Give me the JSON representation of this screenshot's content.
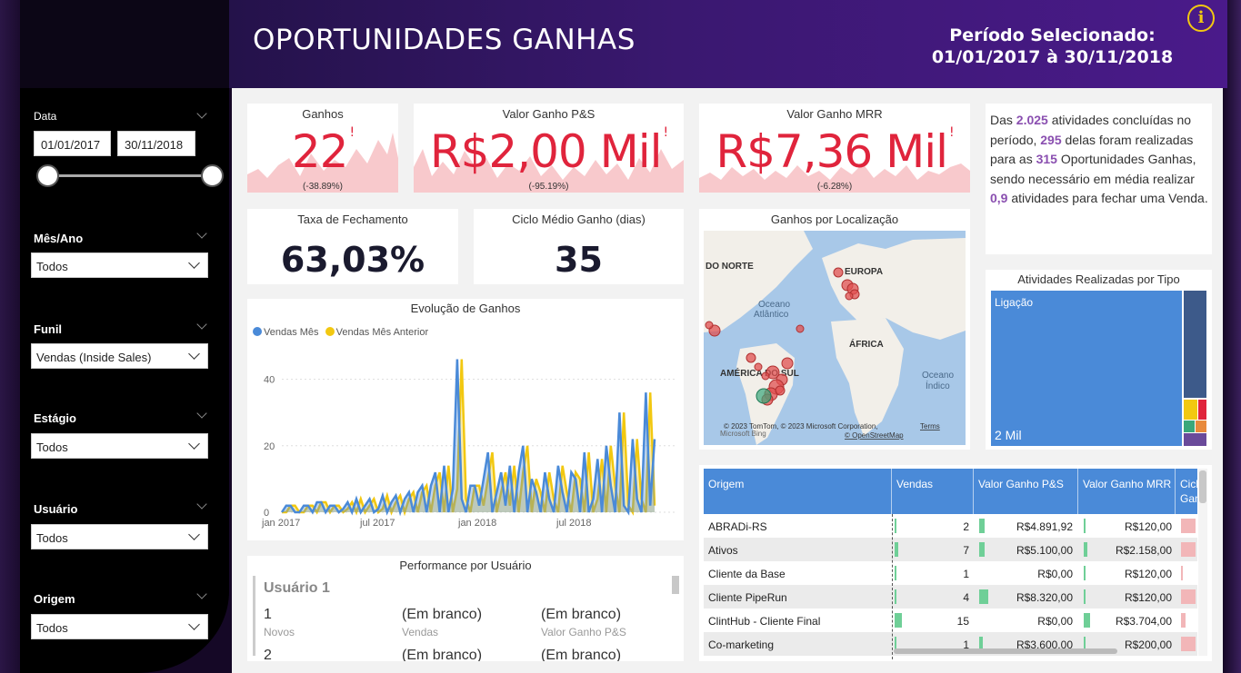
{
  "header": {
    "title": "OPORTUNIDADES GANHAS",
    "period_label": "Período Selecionado:",
    "period_range": "01/01/2017 à 30/11/2018",
    "info_glyph": "i"
  },
  "sidebar": {
    "date_label": "Data",
    "date_start": "01/01/2017",
    "date_end": "30/11/2018",
    "filters": [
      {
        "label": "Mês/Ano",
        "value": "Todos"
      },
      {
        "label": "Funil",
        "value": "Vendas (Inside Sales)"
      },
      {
        "label": "Estágio",
        "value": "Todos"
      },
      {
        "label": "Usuário",
        "value": "Todos"
      },
      {
        "label": "Origem",
        "value": "Todos"
      }
    ]
  },
  "kpis": {
    "ganhos": {
      "title": "Ganhos",
      "value": "22",
      "change": "(-38.89%)",
      "alert": "!"
    },
    "valor_ps": {
      "title": "Valor Ganho P&S",
      "value": "R$2,00 Mil",
      "change": "(-95.19%)",
      "alert": "!"
    },
    "valor_mrr": {
      "title": "Valor Ganho MRR",
      "value": "R$7,36 Mil",
      "change": "(-6.28%)",
      "alert": "!"
    },
    "taxa": {
      "title": "Taxa de Fechamento",
      "value": "63,03%"
    },
    "ciclo": {
      "title": "Ciclo Médio Ganho (dias)",
      "value": "35"
    }
  },
  "summary": {
    "p1": "Das ",
    "n1": "2.025",
    "p2": " atividades concluídas no período, ",
    "n2": "295",
    "p3": " delas foram realizadas para as ",
    "n3": "315",
    "p4": " Oportunidades Ganhas, sendo necessário em média realizar ",
    "n4": "0,9",
    "p5": " atividades para fechar uma Venda."
  },
  "map": {
    "title": "Ganhos por Localização",
    "labels": {
      "norte": "DO NORTE",
      "europa": "EUROPA",
      "atlantico1": "Oceano",
      "atlantico2": "Atlântico",
      "africa": "ÁFRICA",
      "sul": "AMÉRICA DO SUL",
      "indico1": "Oceano",
      "indico2": "Índico"
    },
    "copyright": "© 2023 TomTom, © 2023 Microsoft Corporation,",
    "terms": "Terms",
    "osm": "© OpenStreetMap",
    "bing": "Microsoft Bing",
    "colors": {
      "water": "#a8c8e8",
      "land": "#f2efe9",
      "marker": "#e05050",
      "marker_green": "#3aa77a"
    }
  },
  "treemap": {
    "title": "Atividades Realizadas por Tipo",
    "main_label": "Ligação",
    "main_value": "2 Mil",
    "colors": {
      "main": "#4a8ad8",
      "second": "#3d5a8a"
    }
  },
  "evolution": {
    "title": "Evolução de Ganhos",
    "legend": [
      "Vendas Mês",
      "Vendas Mês Anterior"
    ],
    "colors": {
      "current": "#4a8ad8",
      "previous": "#f2c811"
    }
  },
  "chart_data": {
    "type": "area",
    "title": "Evolução de Ganhos",
    "x_ticks": [
      "jan 2017",
      "jul 2017",
      "jan 2018",
      "jul 2018"
    ],
    "y_ticks": [
      0,
      20,
      40
    ],
    "ylim": [
      0,
      50
    ],
    "series": [
      {
        "name": "Vendas Mês",
        "values": [
          0,
          2,
          2,
          0,
          0,
          2,
          2,
          0,
          3,
          3,
          0,
          2,
          2,
          0,
          1,
          3,
          0,
          4,
          0,
          2,
          4,
          0,
          1,
          5,
          0,
          3,
          5,
          0,
          4,
          6,
          0,
          6,
          8,
          0,
          8,
          12,
          0,
          14,
          0,
          7,
          46,
          4,
          0,
          8,
          8,
          2,
          10,
          18,
          0,
          6,
          12,
          2,
          14,
          0,
          12,
          20,
          0,
          10,
          6,
          0,
          12,
          4,
          0,
          14,
          6,
          0,
          12,
          10,
          0,
          18,
          0,
          4,
          16,
          0,
          20,
          8,
          0,
          30,
          2,
          0,
          22,
          4,
          0,
          36,
          2,
          22
        ]
      },
      {
        "name": "Vendas Mês Anterior",
        "values": [
          0,
          0,
          2,
          2,
          0,
          0,
          2,
          2,
          0,
          3,
          3,
          0,
          2,
          2,
          0,
          1,
          3,
          0,
          4,
          0,
          2,
          4,
          0,
          1,
          5,
          0,
          3,
          5,
          0,
          4,
          6,
          0,
          6,
          8,
          0,
          8,
          12,
          0,
          14,
          0,
          7,
          46,
          4,
          0,
          8,
          8,
          2,
          10,
          18,
          0,
          6,
          12,
          2,
          14,
          0,
          12,
          20,
          0,
          10,
          6,
          0,
          12,
          4,
          0,
          14,
          6,
          0,
          12,
          10,
          0,
          18,
          0,
          4,
          16,
          0,
          20,
          8,
          0,
          30,
          2,
          0,
          22,
          4,
          0,
          36,
          2
        ]
      }
    ],
    "grid": true,
    "legend_position": "top-left"
  },
  "performance": {
    "title": "Performance por Usuário",
    "user": "Usuário 1",
    "rows": [
      [
        {
          "v": "1",
          "l": "Novos"
        },
        {
          "v": "(Em branco)",
          "l": "Vendas"
        },
        {
          "v": "(Em branco)",
          "l": "Valor Ganho P&S"
        }
      ],
      [
        {
          "v": "2",
          "l": ""
        },
        {
          "v": "(Em branco)",
          "l": ""
        },
        {
          "v": "(Em branco)",
          "l": ""
        }
      ]
    ]
  },
  "origin_table": {
    "headers": [
      "Origem",
      "Vendas",
      "Valor Ganho P&S",
      "Valor Ganho MRR",
      "Cicl",
      "Gan"
    ],
    "rows": [
      {
        "origem": "ABRADi-RS",
        "vendas": "2",
        "ps": "R$4.891,92",
        "mrr": "R$120,00",
        "v_frac": 0.13,
        "ps_frac": 0.59,
        "mrr_frac": 0.03,
        "c_frac": 0.9
      },
      {
        "origem": "Ativos",
        "vendas": "7",
        "ps": "R$5.100,00",
        "mrr": "R$2.158,00",
        "v_frac": 0.47,
        "ps_frac": 0.61,
        "mrr_frac": 0.58,
        "c_frac": 0.9
      },
      {
        "origem": "Cliente da Base",
        "vendas": "1",
        "ps": "R$0,00",
        "mrr": "R$120,00",
        "v_frac": 0.07,
        "ps_frac": 0.0,
        "mrr_frac": 0.03,
        "c_frac": 0.1
      },
      {
        "origem": "Cliente PipeRun",
        "vendas": "4",
        "ps": "R$8.320,00",
        "mrr": "R$120,00",
        "v_frac": 0.27,
        "ps_frac": 1.0,
        "mrr_frac": 0.03,
        "c_frac": 0.9
      },
      {
        "origem": "ClintHub - Cliente Final",
        "vendas": "15",
        "ps": "R$0,00",
        "mrr": "R$3.704,00",
        "v_frac": 1.0,
        "ps_frac": 0.0,
        "mrr_frac": 1.0,
        "c_frac": 0.3
      },
      {
        "origem": "Co-marketing",
        "vendas": "1",
        "ps": "R$3.600,00",
        "mrr": "R$200,00",
        "v_frac": 0.07,
        "ps_frac": 0.43,
        "mrr_frac": 0.05,
        "c_frac": 0.9
      }
    ]
  }
}
